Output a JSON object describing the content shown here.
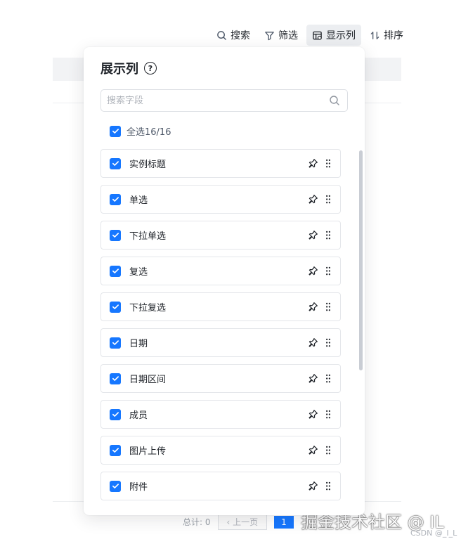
{
  "toolbar": {
    "search_label": "搜索",
    "filter_label": "筛选",
    "columns_label": "显示列",
    "sort_label": "排序"
  },
  "panel": {
    "title": "展示列",
    "search_placeholder": "搜索字段",
    "select_all_label": "全选16/16",
    "items": [
      {
        "label": "实例标题",
        "checked": true
      },
      {
        "label": "单选",
        "checked": true
      },
      {
        "label": "下拉单选",
        "checked": true
      },
      {
        "label": "复选",
        "checked": true
      },
      {
        "label": "下拉复选",
        "checked": true
      },
      {
        "label": "日期",
        "checked": true
      },
      {
        "label": "日期区间",
        "checked": true
      },
      {
        "label": "成员",
        "checked": true
      },
      {
        "label": "图片上传",
        "checked": true
      },
      {
        "label": "附件",
        "checked": true
      }
    ]
  },
  "pager": {
    "total": "总计: 0",
    "prev_label": "上一页",
    "current_page": "1"
  },
  "watermark": {
    "main": "掘金技术社区 @ IL",
    "sub": "CSDN @_I_L"
  },
  "colors": {
    "accent": "#1677ff",
    "active_button_bg": "#eceef1"
  }
}
